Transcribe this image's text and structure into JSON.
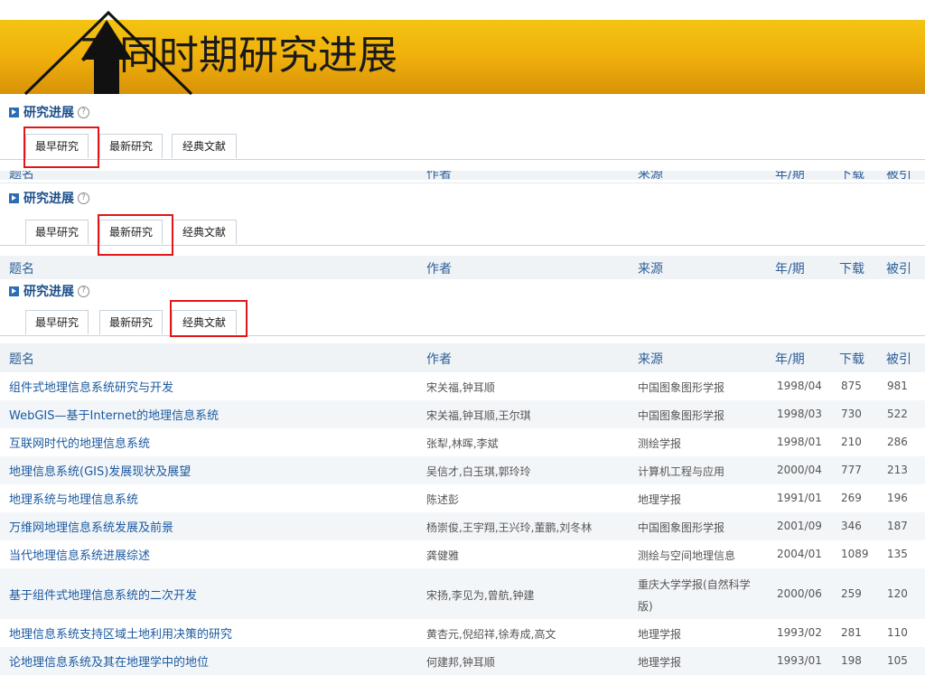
{
  "slide": {
    "title": "不同时期研究进展"
  },
  "panel": {
    "heading": "研究进展",
    "help_glyph": "?",
    "tabs": [
      "最早研究",
      "最新研究",
      "经典文献"
    ]
  },
  "table": {
    "headers": {
      "title": "题名",
      "author": "作者",
      "source": "来源",
      "issue": "年/期",
      "downloads": "下载",
      "cited": "被引"
    },
    "rows": [
      {
        "title": "组件式地理信息系统研究与开发",
        "author": "宋关福,钟耳顺",
        "source": "中国图象图形学报",
        "issue": "1998/04",
        "downloads": "875",
        "cited": "981"
      },
      {
        "title": "WebGIS—基于Internet的地理信息系统",
        "author": "宋关福,钟耳顺,王尔琪",
        "source": "中国图象图形学报",
        "issue": "1998/03",
        "downloads": "730",
        "cited": "522"
      },
      {
        "title": "互联网时代的地理信息系统",
        "author": "张犁,林晖,李斌",
        "source": "测绘学报",
        "issue": "1998/01",
        "downloads": "210",
        "cited": "286"
      },
      {
        "title": "地理信息系统(GIS)发展现状及展望",
        "author": "吴信才,白玉琪,郭玲玲",
        "source": "计算机工程与应用",
        "issue": "2000/04",
        "downloads": "777",
        "cited": "213"
      },
      {
        "title": "地理系统与地理信息系统",
        "author": "陈述彭",
        "source": "地理学报",
        "issue": "1991/01",
        "downloads": "269",
        "cited": "196"
      },
      {
        "title": "万维网地理信息系统发展及前景",
        "author": "杨崇俊,王宇翔,王兴玲,董鹏,刘冬林",
        "source": "中国图象图形学报",
        "issue": "2001/09",
        "downloads": "346",
        "cited": "187"
      },
      {
        "title": "当代地理信息系统进展综述",
        "author": "龚健雅",
        "source": "测绘与空间地理信息",
        "issue": "2004/01",
        "downloads": "1089",
        "cited": "135"
      },
      {
        "title": "基于组件式地理信息系统的二次开发",
        "author": "宋扬,李见为,曾航,钟建",
        "source_line1": "重庆大学学报(自然科学",
        "source_line2": "版)",
        "issue": "2000/06",
        "downloads": "259",
        "cited": "120"
      },
      {
        "title": "地理信息系统支持区域土地利用决策的研究",
        "author": "黄杏元,倪绍祥,徐寿成,高文",
        "source": "地理学报",
        "issue": "1993/02",
        "downloads": "281",
        "cited": "110"
      },
      {
        "title": "论地理信息系统及其在地理学中的地位",
        "author": "何建邦,钟耳顺",
        "source": "地理学报",
        "issue": "1993/01",
        "downloads": "198",
        "cited": "105"
      }
    ]
  },
  "colors": {
    "banner": "#f0b00c",
    "highlight": "#e0161b",
    "link": "#1c5aa0",
    "header_text": "#2c5f98"
  }
}
